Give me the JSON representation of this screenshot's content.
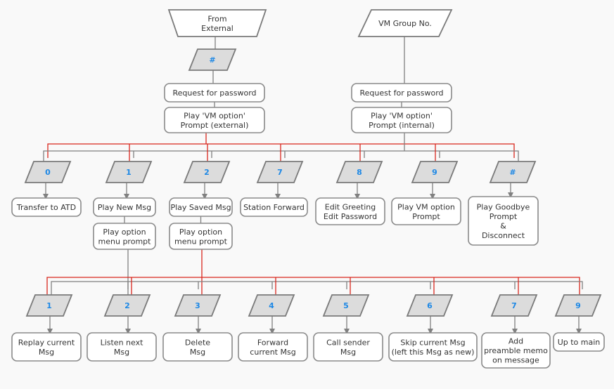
{
  "colors": {
    "external_path": "#d9261c",
    "internal_path": "#808080",
    "key_text": "#1e88e5"
  },
  "top": {
    "external_source": [
      "From",
      "External"
    ],
    "internal_source": [
      "VM Group No."
    ],
    "external_key": "#",
    "external_request": [
      "Request for password"
    ],
    "external_prompt": [
      "Play 'VM option'",
      "Prompt (external)"
    ],
    "internal_request": [
      "Request for password"
    ],
    "internal_prompt": [
      "Play 'VM option'",
      "Prompt (internal)"
    ]
  },
  "main_menu": [
    {
      "key": "0",
      "action": [
        "Transfer to ATD"
      ]
    },
    {
      "key": "1",
      "action": [
        "Play New Msg"
      ],
      "sub": [
        "Play option",
        "menu prompt"
      ]
    },
    {
      "key": "2",
      "action": [
        "Play Saved Msg"
      ],
      "sub": [
        "Play option",
        "menu prompt"
      ]
    },
    {
      "key": "7",
      "action": [
        "Station Forward"
      ]
    },
    {
      "key": "8",
      "action": [
        "Edit Greeting",
        "Edit Password"
      ]
    },
    {
      "key": "9",
      "action": [
        "Play VM option",
        "Prompt"
      ]
    },
    {
      "key": "#",
      "action": [
        "Play Goodbye",
        "Prompt",
        "&",
        "Disconnect"
      ]
    }
  ],
  "message_menu": [
    {
      "key": "1",
      "action": [
        "Replay current",
        "Msg"
      ]
    },
    {
      "key": "2",
      "action": [
        "Listen next",
        "Msg"
      ]
    },
    {
      "key": "3",
      "action": [
        "Delete",
        "Msg"
      ]
    },
    {
      "key": "4",
      "action": [
        "Forward",
        "current Msg"
      ]
    },
    {
      "key": "5",
      "action": [
        "Call sender",
        "Msg"
      ]
    },
    {
      "key": "6",
      "action": [
        "Skip current Msg",
        "(left this Msg as new)"
      ]
    },
    {
      "key": "7",
      "action": [
        "Add",
        "preamble memo",
        "on message"
      ]
    },
    {
      "key": "9",
      "action": [
        "Up to main"
      ]
    }
  ]
}
